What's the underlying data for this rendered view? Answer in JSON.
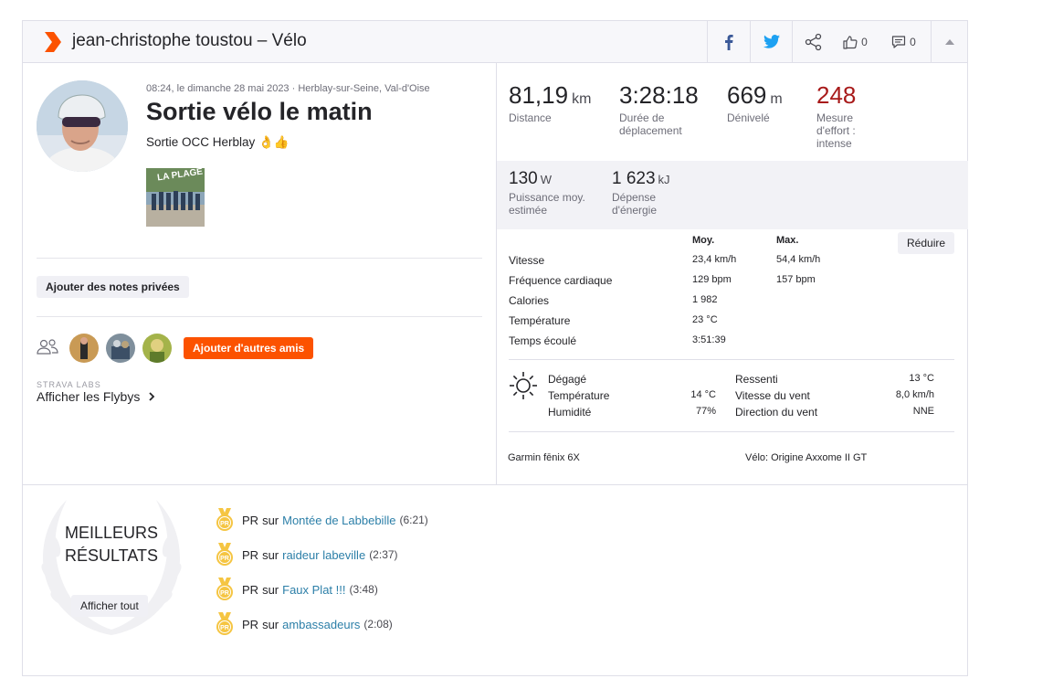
{
  "header": {
    "title": "jean-christophe toustou – Vélo",
    "kudos_count": "0",
    "comments_count": "0"
  },
  "activity": {
    "meta": "08:24, le dimanche 28 mai 2023 · Herblay-sur-Seine, Val-d'Oise",
    "title": "Sortie vélo le matin",
    "description": "Sortie OCC Herblay 👌👍",
    "photo_caption": "LA PLAGE"
  },
  "left": {
    "private_notes_button": "Ajouter des notes privées",
    "add_friends_button": "Ajouter d'autres amis",
    "labs_label": "STRAVA LABS",
    "flyby_link": "Afficher les Flybys"
  },
  "stats": {
    "primary": [
      {
        "value": "81,19",
        "unit": "km",
        "label": "Distance"
      },
      {
        "value": "3:28:18",
        "unit": "",
        "label": "Durée de déplacement"
      },
      {
        "value": "669",
        "unit": "m",
        "label": "Dénivelé"
      },
      {
        "value": "248",
        "unit": "",
        "label": "Mesure d'effort : intense"
      }
    ],
    "secondary": [
      {
        "value": "130",
        "unit": "W",
        "label": "Puissance moy. estimée"
      },
      {
        "value": "1 623",
        "unit": "kJ",
        "label": "Dépense d'énergie"
      }
    ]
  },
  "details": {
    "col_avg": "Moy.",
    "col_max": "Max.",
    "reduce_button": "Réduire",
    "rows": [
      {
        "label": "Vitesse",
        "avg": "23,4 km/h",
        "max": "54,4 km/h"
      },
      {
        "label": "Fréquence cardiaque",
        "avg": "129 bpm",
        "max": "157 bpm"
      },
      {
        "label": "Calories",
        "avg": "1 982",
        "max": ""
      },
      {
        "label": "Température",
        "avg": "23 °C",
        "max": ""
      },
      {
        "label": "Temps écoulé",
        "avg": "3:51:39",
        "max": ""
      }
    ]
  },
  "weather": {
    "condition": "Dégagé",
    "temp_label": "Température",
    "temp_value": "14 °C",
    "humidity_label": "Humidité",
    "humidity_value": "77%",
    "feels_label": "Ressenti",
    "feels_value": "13 °C",
    "wind_speed_label": "Vitesse du vent",
    "wind_speed_value": "8,0 km/h",
    "wind_dir_label": "Direction du vent",
    "wind_dir_value": "NNE"
  },
  "gear": {
    "device": "Garmin fēnix 6X",
    "bike": "Vélo: Origine Axxome II GT"
  },
  "best": {
    "title_line1": "MEILLEURS",
    "title_line2": "RÉSULTATS",
    "show_all_button": "Afficher tout",
    "badge_text": "PR",
    "on_word": "sur",
    "items": [
      {
        "segment": "Montée de Labbebille",
        "time": "(6:21)"
      },
      {
        "segment": "raideur labeville",
        "time": "(2:37)"
      },
      {
        "segment": "Faux Plat !!!",
        "time": "(3:48)"
      },
      {
        "segment": "ambassadeurs",
        "time": "(2:08)"
      }
    ]
  },
  "colors": {
    "strava_orange": "#fc5200",
    "effort_red": "#a81a1a",
    "link_blue": "#2c7fa8",
    "facebook_blue": "#3b5998",
    "twitter_blue": "#1da1f2",
    "medal_gold": "#f5c542"
  }
}
